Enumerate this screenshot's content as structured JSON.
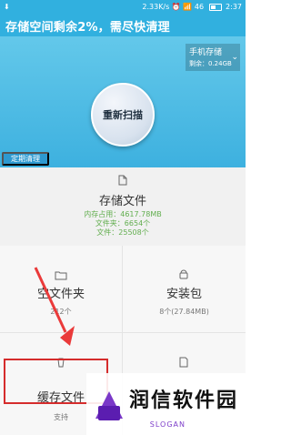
{
  "status_bar": {
    "left_icon": "download-icon",
    "right_text": "2.33K/s ⏰ 📶 46",
    "time": "2:37"
  },
  "header": {
    "title": "存储空间剩余2%，需尽快清理"
  },
  "storage_chip": {
    "title": "手机存储",
    "remaining": "剩余：0.24GB",
    "chevron_icon": "chevron-down-icon"
  },
  "scan_button": {
    "label": "重新扫描"
  },
  "schedule_button": {
    "label": "定期清理"
  },
  "storage_files": {
    "title": "存储文件",
    "memory_usage": "内存占用：4617.78MB",
    "folders": "文件夹：6654个",
    "files": "文件：25508个"
  },
  "grid": {
    "empty_folder": {
      "label": "空文件夹",
      "sub": "212个"
    },
    "install_package": {
      "label": "安装包",
      "sub": "8个(27.84MB)"
    },
    "cache": {
      "label": "缓存文件",
      "sub": "支持"
    },
    "other": {
      "label": "",
      "sub": ""
    }
  },
  "watermark": {
    "brand": "润信软件园",
    "slogan": "SLOGAN"
  },
  "accent_colors": {
    "header": "#31b0df",
    "schedule": "#2d99d0",
    "green_text": "#62ae4f",
    "red_box": "#d52c2c",
    "arrow": "#ea3a3a"
  }
}
